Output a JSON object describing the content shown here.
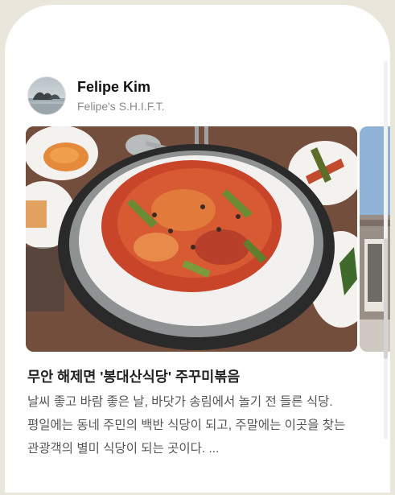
{
  "post": {
    "author_name": "Felipe Kim",
    "blog_name": "Felipe's S.H.I.F.T.",
    "title": "무안 해제면 '봉대산식당' 주꾸미볶음",
    "excerpt": "날씨 좋고 바람 좋은 날, 바닷가 송림에서 놀기 전 들른 식당. 평일에는 동네 주민의 백반 식당이 되고, 주말에는 이곳을 찾는 관광객의 별미 식당이 되는 곳이다. ..."
  },
  "icons": {
    "avatar": "avatar-island-photo",
    "photo": "food-photo-stir-fried-webfoot-octopus",
    "next_photo": "building-photo"
  }
}
